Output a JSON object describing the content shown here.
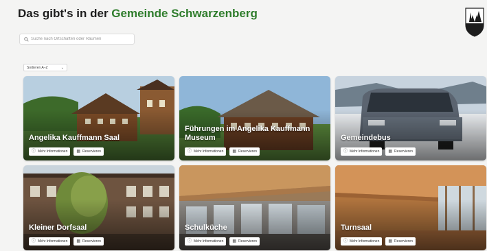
{
  "header": {
    "title_prefix": "Das gibt's in der ",
    "title_accent": "Gemeinde Schwarzenberg",
    "accent_color": "#2f7d2c"
  },
  "crest": {
    "icon": "municipal-crest-icon"
  },
  "search": {
    "placeholder": "Suche nach Ortschaften oder Räumen"
  },
  "sort": {
    "label": "Sortieren A–Z",
    "icon": "chevron-down-icon"
  },
  "cards": [
    {
      "name": "Angelika Kauffmann Saal",
      "info_label": "Mehr Informationen",
      "reserve_label": "Reservieren"
    },
    {
      "name": "Führungen im Angelika Kauffmann Museum",
      "info_label": "Mehr Informationen",
      "reserve_label": "Reservieren"
    },
    {
      "name": "Gemeindebus",
      "info_label": "Mehr Informationen",
      "reserve_label": "Reservieren"
    },
    {
      "name": "Kleiner Dorfsaal",
      "info_label": "Mehr Informationen",
      "reserve_label": "Reservieren"
    },
    {
      "name": "Schulküche",
      "info_label": "Mehr Informationen",
      "reserve_label": "Reservieren"
    },
    {
      "name": "Turnsaal",
      "info_label": "Mehr Informationen",
      "reserve_label": "Reservieren"
    }
  ]
}
